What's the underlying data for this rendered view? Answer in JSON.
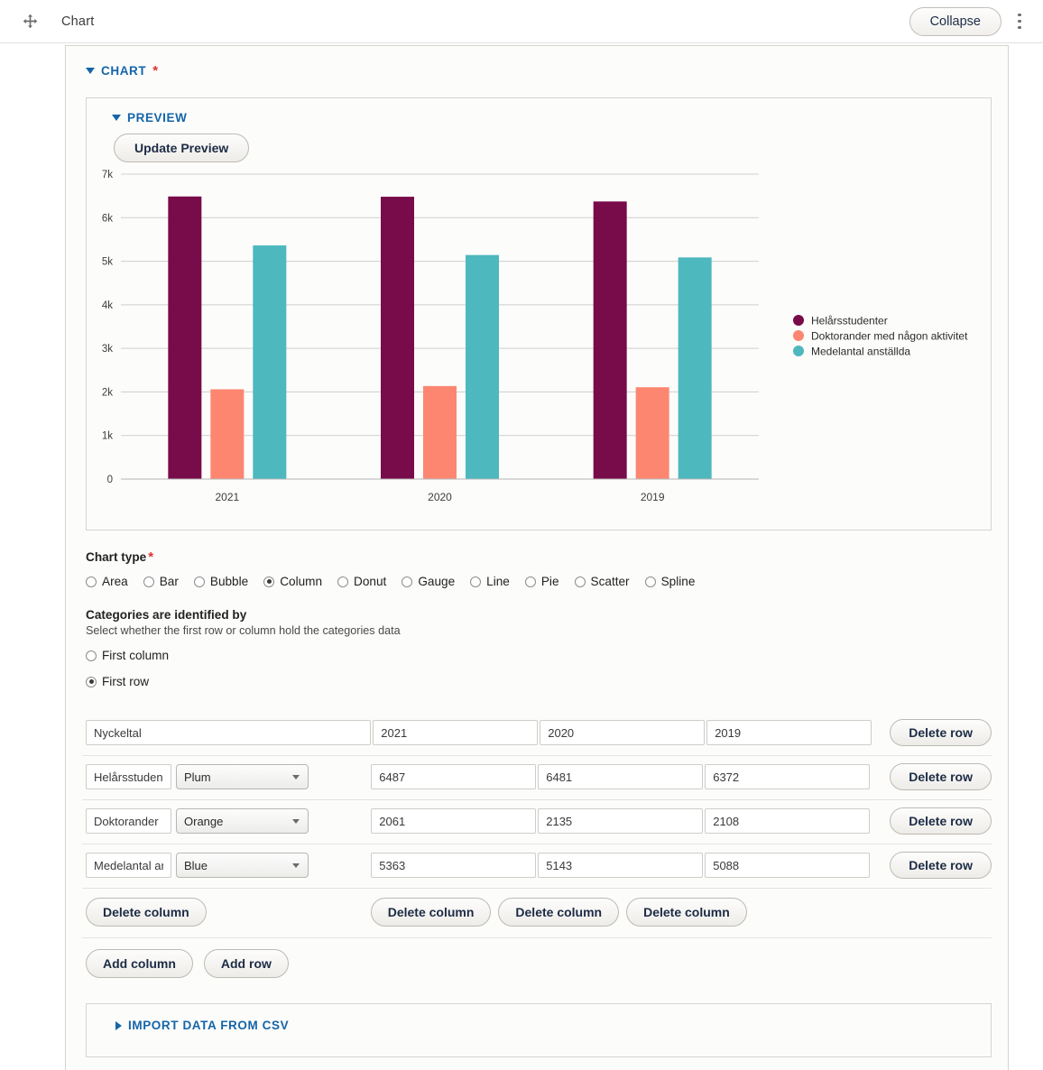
{
  "topbar": {
    "move_icon": "move-handle-icon",
    "title": "Chart",
    "collapse_label": "Collapse",
    "kebab_icon": "more-options-icon"
  },
  "chart_section": {
    "heading": "CHART",
    "required_marker": "*"
  },
  "preview": {
    "heading": "PREVIEW",
    "update_label": "Update Preview"
  },
  "chart_data": {
    "type": "bar",
    "title": "",
    "xlabel": "",
    "ylabel": "",
    "categories": [
      "2021",
      "2020",
      "2019"
    ],
    "ylim": [
      0,
      7000
    ],
    "yticks": [
      0,
      1000,
      2000,
      3000,
      4000,
      5000,
      6000,
      7000
    ],
    "ytick_labels": [
      "0",
      "1k",
      "2k",
      "3k",
      "4k",
      "5k",
      "6k",
      "7k"
    ],
    "grid": true,
    "legend_position": "right",
    "series": [
      {
        "name": "Helårsstudenter",
        "color": "#780b49",
        "values": [
          6487,
          6481,
          6372
        ]
      },
      {
        "name": "Doktorander med någon aktivitet",
        "color": "#fd8671",
        "values": [
          2061,
          2135,
          2108
        ]
      },
      {
        "name": "Medelantal anställda",
        "color": "#4db8be",
        "values": [
          5363,
          5143,
          5088
        ]
      }
    ]
  },
  "chart_type": {
    "label": "Chart type",
    "required_marker": "*",
    "selected": "Column",
    "options": [
      "Area",
      "Bar",
      "Bubble",
      "Column",
      "Donut",
      "Gauge",
      "Line",
      "Pie",
      "Scatter",
      "Spline"
    ]
  },
  "categories_by": {
    "label": "Categories are identified by",
    "description": "Select whether the first row or column hold the categories data",
    "selected": "First row",
    "options": [
      "First column",
      "First row"
    ]
  },
  "data_grid": {
    "header_row": {
      "name": "Nyckeltal",
      "values": [
        "2021",
        "2020",
        "2019"
      ],
      "delete_label": "Delete row"
    },
    "rows": [
      {
        "name": "Helårsstuden",
        "color_label": "Plum",
        "values": [
          "6487",
          "6481",
          "6372"
        ],
        "delete_label": "Delete row"
      },
      {
        "name": "Doktorander",
        "color_label": "Orange",
        "values": [
          "2061",
          "2135",
          "2108"
        ],
        "delete_label": "Delete row"
      },
      {
        "name": "Medelantal ar",
        "color_label": "Blue",
        "values": [
          "5363",
          "5143",
          "5088"
        ],
        "delete_label": "Delete row"
      }
    ],
    "delete_column_labels": [
      "Delete column",
      "Delete column",
      "Delete column",
      "Delete column"
    ],
    "add_column_label": "Add column",
    "add_row_label": "Add row"
  },
  "csv_section": {
    "heading": "IMPORT DATA FROM CSV"
  }
}
